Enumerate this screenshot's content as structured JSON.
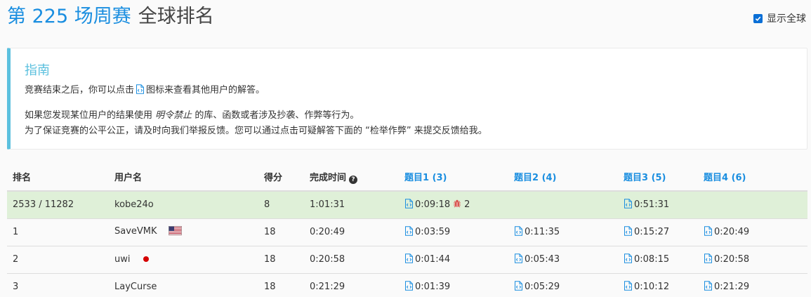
{
  "header": {
    "contest_title": "第 225 场周赛",
    "rank_title": "全球排名",
    "global_toggle_label": "显示全球",
    "global_toggle_checked": true
  },
  "guide": {
    "title": "指南",
    "line1_before": "竞赛结束之后，你可以点击",
    "line1_after": "图标来查看其他用户的解答。",
    "line2_before": "如果您发现某位用户的结果使用",
    "line2_em": "明令禁止",
    "line2_after": "的库、函数或者涉及抄袭、作弊等行为。",
    "line3": "为了保证竞赛的公平公正，请及时向我们举报反馈。您可以通过点击可疑解答下面的 “检举作弊” 来提交反馈给我。"
  },
  "table": {
    "headers": {
      "rank": "排名",
      "username": "用户名",
      "score": "得分",
      "finish_time": "完成时间",
      "q1": "题目1 (3)",
      "q2": "题目2 (4)",
      "q3": "题目3 (5)",
      "q4": "题目4 (6)"
    },
    "my_row": {
      "rank": "2533 / 11282",
      "username": "kobe24o",
      "score": "8",
      "finish_time": "1:01:31",
      "q1": "0:09:18",
      "q1_bugs": "2",
      "q3": "0:51:31"
    },
    "rows": [
      {
        "rank": "1",
        "username": "SaveVMK",
        "flag": "us-flag",
        "score": "18",
        "finish_time": "0:20:49",
        "q1": "0:03:59",
        "q2": "0:11:35",
        "q3": "0:15:27",
        "q4": "0:20:49"
      },
      {
        "rank": "2",
        "username": "uwi",
        "flag": "jp-flag",
        "score": "18",
        "finish_time": "0:20:58",
        "q1": "0:01:44",
        "q2": "0:05:43",
        "q3": "0:08:15",
        "q4": "0:20:58"
      },
      {
        "rank": "3",
        "username": "LayCurse",
        "flag": "",
        "score": "18",
        "finish_time": "0:21:29",
        "q1": "0:01:39",
        "q2": "0:05:29",
        "q3": "0:10:12",
        "q4": "0:21:29"
      }
    ]
  },
  "colors": {
    "accent": "#1a8ee0",
    "guide_accent": "#5bc0de",
    "my_row_bg": "#dff0d8",
    "bug": "#d9534f"
  },
  "icons": {
    "code": "code-file-icon",
    "help": "question-circle-icon",
    "bug": "bug-icon",
    "check": "checkbox-checked-icon"
  }
}
